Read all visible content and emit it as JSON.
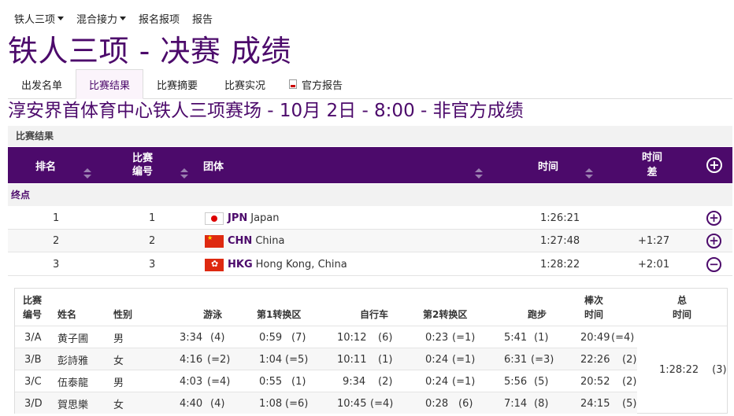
{
  "nav": {
    "items": [
      {
        "label": "铁人三项",
        "dropdown": true
      },
      {
        "label": "混合接力",
        "dropdown": true
      },
      {
        "label": "报名报项",
        "dropdown": false
      },
      {
        "label": "报告",
        "dropdown": false
      }
    ]
  },
  "page_title": "铁人三项 - 决赛 成绩",
  "tabs": [
    "出发名单",
    "比赛结果",
    "比赛摘要",
    "比赛实况",
    "官方报告"
  ],
  "subtitle": "淳安界首体育中心铁人三项赛场 - 10月 2日 - 8:00 - 非官方成绩",
  "section_label": "比赛结果",
  "columns": {
    "rank": "排名",
    "bib_1": "比赛",
    "bib_2": "编号",
    "team": "团体",
    "time": "时间",
    "diff_1": "时间",
    "diff_2": "差"
  },
  "group_label": "终点",
  "results": [
    {
      "rank": "1",
      "bib": "1",
      "noc": "JPN",
      "team": "Japan",
      "time": "1:26:21",
      "diff": "",
      "expand": "+"
    },
    {
      "rank": "2",
      "bib": "2",
      "noc": "CHN",
      "team": "China",
      "time": "1:27:48",
      "diff": "+1:27",
      "expand": "+"
    },
    {
      "rank": "3",
      "bib": "3",
      "noc": "HKG",
      "team": "Hong Kong, China",
      "time": "1:28:22",
      "diff": "+2:01",
      "expand": "−"
    }
  ],
  "splits": {
    "headers": {
      "bib_1": "比赛",
      "bib_2": "编号",
      "name": "姓名",
      "gender": "性别",
      "swim": "游泳",
      "t1": "第1转换区",
      "bike": "自行车",
      "t2": "第2转换区",
      "run": "跑步",
      "leg_1": "棒次",
      "leg_2": "时间",
      "total_1": "总",
      "total_2": "时间"
    },
    "rows": [
      {
        "bib": "3/A",
        "name": "黄子圃",
        "gender": "男",
        "swim": "3:34",
        "swim_r": "(4)",
        "t1": "0:59",
        "t1_r": "(7)",
        "bike": "10:12",
        "bike_r": "(6)",
        "t2": "0:23",
        "t2_r": "(=1)",
        "run": "5:41",
        "run_r": "(1)",
        "leg": "20:49",
        "leg_r": "(=4)"
      },
      {
        "bib": "3/B",
        "name": "彭詩雅",
        "gender": "女",
        "swim": "4:16",
        "swim_r": "(=2)",
        "t1": "1:04",
        "t1_r": "(=5)",
        "bike": "10:11",
        "bike_r": "(1)",
        "t2": "0:24",
        "t2_r": "(=1)",
        "run": "6:31",
        "run_r": "(=3)",
        "leg": "22:26",
        "leg_r": "(2)"
      },
      {
        "bib": "3/C",
        "name": "伍泰龍",
        "gender": "男",
        "swim": "4:03",
        "swim_r": "(=4)",
        "t1": "0:55",
        "t1_r": "(1)",
        "bike": "9:34",
        "bike_r": "(2)",
        "t2": "0:24",
        "t2_r": "(=1)",
        "run": "5:56",
        "run_r": "(5)",
        "leg": "20:52",
        "leg_r": "(2)"
      },
      {
        "bib": "3/D",
        "name": "賀思樂",
        "gender": "女",
        "swim": "4:40",
        "swim_r": "(4)",
        "t1": "1:08",
        "t1_r": "(=6)",
        "bike": "10:45",
        "bike_r": "(=4)",
        "t2": "0:28",
        "t2_r": "(6)",
        "run": "7:14",
        "run_r": "(8)",
        "leg": "24:15",
        "leg_r": "(5)"
      }
    ],
    "total_time": "1:28:22",
    "total_rank": "(3)"
  }
}
